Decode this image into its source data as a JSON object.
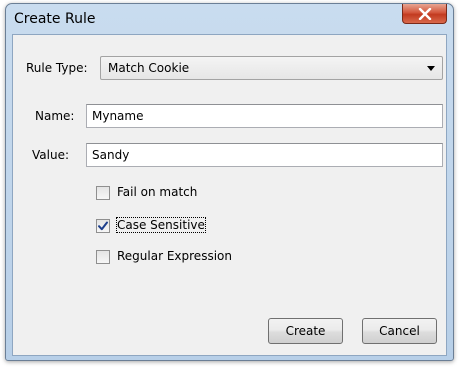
{
  "dialog": {
    "title": "Create Rule",
    "close_glyph": "X"
  },
  "rule_type": {
    "label": "Rule Type:",
    "selected": "Match Cookie"
  },
  "name_field": {
    "label": "Name:",
    "value": "Myname"
  },
  "value_field": {
    "label": "Value:",
    "value": "Sandy"
  },
  "options": [
    {
      "label": "Fail on match",
      "checked": false
    },
    {
      "label": "Case Sensitive",
      "checked": true
    },
    {
      "label": "Regular Expression",
      "checked": false
    }
  ],
  "buttons": {
    "create": "Create",
    "cancel": "Cancel"
  },
  "icons": {
    "close": "close-icon",
    "dropdown": "chevron-down-icon",
    "check": "checkmark-icon"
  },
  "colors": {
    "title_bar": "#b7cfe8",
    "close_button": "#c23a20",
    "dialog_bg": "#f0f0f0",
    "check_mark": "#1d3f8c"
  }
}
